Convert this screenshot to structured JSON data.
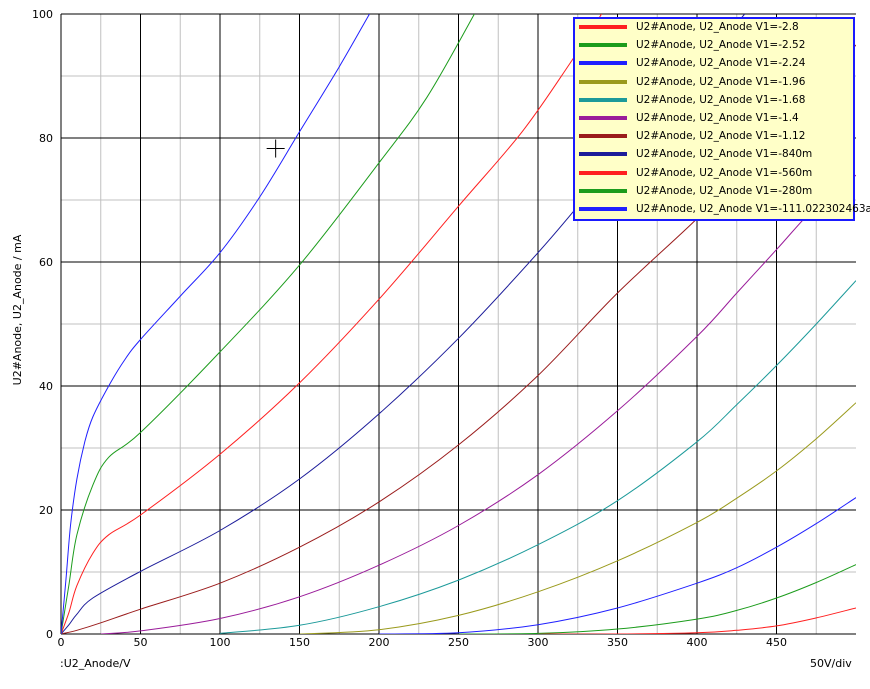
{
  "chart_data": {
    "type": "line",
    "x_axis_label": "U2_Anode/V",
    "x_axis_label_prefix": ":",
    "x_scale_label": "50V/div",
    "ylabel": "U2#Anode, U2_Anode / mA",
    "xlim": [
      0,
      500
    ],
    "ylim": [
      0,
      100
    ],
    "x_ticks": [
      "0",
      "50",
      "100",
      "150",
      "200",
      "250",
      "300",
      "350",
      "400",
      "450"
    ],
    "y_ticks": [
      "0",
      "20",
      "40",
      "60",
      "80",
      "100"
    ],
    "grid": true,
    "legend_position": "top-right",
    "cursor": {
      "x": 135,
      "y": 78.3
    },
    "series": [
      {
        "name": "U2#Anode, U2_Anode V1=-2.8",
        "color": "#ff2020",
        "points": [
          [
            300,
            0
          ],
          [
            350,
            0
          ],
          [
            400,
            0.2
          ],
          [
            425,
            0.6
          ],
          [
            450,
            1.3
          ],
          [
            475,
            2.6
          ],
          [
            500,
            4.2
          ]
        ]
      },
      {
        "name": "U2#Anode, U2_Anode V1=-2.52",
        "color": "#1c9c1c",
        "points": [
          [
            250,
            0
          ],
          [
            300,
            0.1
          ],
          [
            350,
            0.8
          ],
          [
            400,
            2.4
          ],
          [
            425,
            3.8
          ],
          [
            450,
            5.8
          ],
          [
            475,
            8.3
          ],
          [
            500,
            11.2
          ]
        ]
      },
      {
        "name": "U2#Anode, U2_Anode V1=-2.24",
        "color": "#2020ff",
        "points": [
          [
            200,
            0
          ],
          [
            250,
            0.2
          ],
          [
            300,
            1.5
          ],
          [
            350,
            4.2
          ],
          [
            400,
            8.2
          ],
          [
            425,
            10.7
          ],
          [
            450,
            14.0
          ],
          [
            475,
            17.8
          ],
          [
            500,
            22.0
          ]
        ]
      },
      {
        "name": "U2#Anode, U2_Anode V1=-1.96",
        "color": "#9a9a1c",
        "points": [
          [
            150,
            0
          ],
          [
            200,
            0.7
          ],
          [
            250,
            3.0
          ],
          [
            300,
            6.8
          ],
          [
            350,
            11.8
          ],
          [
            400,
            18.0
          ],
          [
            425,
            21.9
          ],
          [
            450,
            26.3
          ],
          [
            475,
            31.5
          ],
          [
            500,
            37.3
          ]
        ]
      },
      {
        "name": "U2#Anode, U2_Anode V1=-1.68",
        "color": "#1c9a9a",
        "points": [
          [
            100,
            0.1
          ],
          [
            150,
            1.4
          ],
          [
            200,
            4.4
          ],
          [
            250,
            8.7
          ],
          [
            300,
            14.4
          ],
          [
            350,
            21.5
          ],
          [
            400,
            31.0
          ],
          [
            425,
            37.0
          ],
          [
            450,
            43.3
          ],
          [
            475,
            50.0
          ],
          [
            500,
            57.0
          ]
        ]
      },
      {
        "name": "U2#Anode, U2_Anode V1=-1.4",
        "color": "#9a1c9a",
        "points": [
          [
            25,
            0
          ],
          [
            50,
            0.5
          ],
          [
            100,
            2.5
          ],
          [
            150,
            6.0
          ],
          [
            200,
            11.1
          ],
          [
            250,
            17.5
          ],
          [
            300,
            25.7
          ],
          [
            350,
            36.0
          ],
          [
            400,
            48.0
          ],
          [
            425,
            55.0
          ],
          [
            450,
            62.0
          ],
          [
            475,
            69.0
          ],
          [
            500,
            74.0
          ]
        ]
      },
      {
        "name": "U2#Anode, U2_Anode V1=-1.12",
        "color": "#9a1c1c",
        "points": [
          [
            0,
            0
          ],
          [
            10,
            0.6
          ],
          [
            25,
            1.8
          ],
          [
            50,
            4.0
          ],
          [
            100,
            8.2
          ],
          [
            150,
            14.0
          ],
          [
            200,
            21.3
          ],
          [
            250,
            30.5
          ],
          [
            300,
            41.7
          ],
          [
            350,
            55.0
          ],
          [
            400,
            67.0
          ],
          [
            425,
            74.0
          ],
          [
            450,
            81.0
          ],
          [
            475,
            88.0
          ],
          [
            500,
            95.0
          ]
        ]
      },
      {
        "name": "U2#Anode, U2_Anode V1=-840m",
        "color": "#1c1c9a",
        "points": [
          [
            0,
            0
          ],
          [
            5,
            1.5
          ],
          [
            10,
            3.2
          ],
          [
            20,
            5.8
          ],
          [
            50,
            10.1
          ],
          [
            100,
            16.7
          ],
          [
            150,
            25.0
          ],
          [
            200,
            35.5
          ],
          [
            250,
            47.7
          ],
          [
            300,
            61.5
          ],
          [
            330,
            70.5
          ],
          [
            355,
            78.0
          ],
          [
            380,
            85.5
          ],
          [
            405,
            92.5
          ],
          [
            430,
            100
          ]
        ]
      },
      {
        "name": "U2#Anode, U2_Anode V1=-560m",
        "color": "#ff2020",
        "points": [
          [
            0,
            0
          ],
          [
            5,
            3.5
          ],
          [
            10,
            7.8
          ],
          [
            20,
            13.0
          ],
          [
            30,
            16.0
          ],
          [
            50,
            19.2
          ],
          [
            100,
            29.0
          ],
          [
            150,
            40.5
          ],
          [
            200,
            54.0
          ],
          [
            250,
            69.0
          ],
          [
            290,
            81.0
          ],
          [
            320,
            92.0
          ],
          [
            340,
            100
          ]
        ]
      },
      {
        "name": "U2#Anode, U2_Anode V1=-280m",
        "color": "#1c9c1c",
        "points": [
          [
            0,
            0
          ],
          [
            5,
            8.0
          ],
          [
            10,
            16.0
          ],
          [
            20,
            24.0
          ],
          [
            30,
            28.5
          ],
          [
            50,
            32.5
          ],
          [
            100,
            45.5
          ],
          [
            150,
            59.5
          ],
          [
            200,
            76.0
          ],
          [
            230,
            86.5
          ],
          [
            260,
            100
          ]
        ]
      },
      {
        "name": "U2#Anode, U2_Anode V1=-111.022302463a",
        "color": "#2020ff",
        "points": [
          [
            0,
            0
          ],
          [
            3,
            8.5
          ],
          [
            6,
            17.5
          ],
          [
            10,
            25.0
          ],
          [
            15,
            31.0
          ],
          [
            20,
            35.0
          ],
          [
            30,
            40.0
          ],
          [
            40,
            44.2
          ],
          [
            50,
            47.5
          ],
          [
            75,
            54.5
          ],
          [
            100,
            61.5
          ],
          [
            125,
            70.5
          ],
          [
            150,
            81.0
          ],
          [
            175,
            91.5
          ],
          [
            194,
            100
          ]
        ]
      }
    ]
  }
}
